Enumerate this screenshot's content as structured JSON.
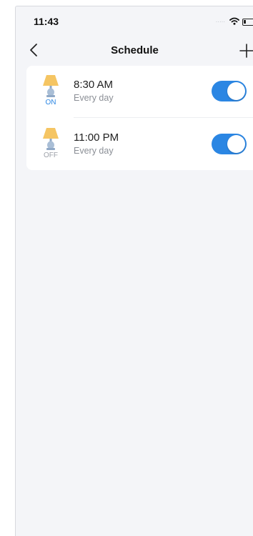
{
  "status_bar": {
    "time": "11:43",
    "signal": "·····",
    "icons": [
      "wifi-icon",
      "battery-icon"
    ]
  },
  "nav": {
    "title": "Schedule",
    "back_icon": "chevron-left-icon",
    "add_icon": "plus-icon"
  },
  "schedules": [
    {
      "time": "8:30 AM",
      "repeat": "Every day",
      "action": "ON",
      "enabled": true
    },
    {
      "time": "11:00 PM",
      "repeat": "Every day",
      "action": "OFF",
      "enabled": true
    }
  ],
  "colors": {
    "accent": "#2b86e3",
    "lamp_shade": "#f5c563",
    "lamp_base": "#a9bed6",
    "background": "#f4f5f8",
    "off_text": "#9ca0a8"
  }
}
